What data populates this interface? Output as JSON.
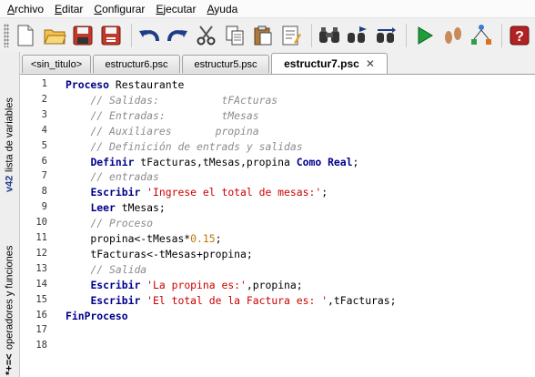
{
  "menu": [
    "Archivo",
    "Editar",
    "Configurar",
    "Ejecutar",
    "Ayuda"
  ],
  "toolbar_icons": [
    "new-file-icon",
    "open-folder-icon",
    "save-icon",
    "save-as-icon",
    "undo-icon",
    "redo-icon",
    "cut-icon",
    "copy-icon",
    "paste-icon",
    "edit-flow-icon",
    "search-icon",
    "search-next-icon",
    "replace-icon",
    "run-icon",
    "step-by-step-icon",
    "explain-icon",
    "help-icon"
  ],
  "sidebar": {
    "variables_icon": "v⁢42",
    "variables_label": "lista de variables",
    "operators_icon": "*+=<",
    "operators_label": "operadores y funciones"
  },
  "tabs": [
    {
      "label": "<sin_titulo>",
      "active": false
    },
    {
      "label": "estructur6.psc",
      "active": false
    },
    {
      "label": "estructur5.psc",
      "active": false
    },
    {
      "label": "estructur7.psc",
      "active": true
    }
  ],
  "tab_close": "✕",
  "editor": {
    "line_numbers": [
      "1",
      "2",
      "3",
      "4",
      "5",
      "6",
      "7",
      "8",
      "9",
      "10",
      "11",
      "12",
      "13",
      "14",
      "15",
      "16",
      "17",
      "18"
    ],
    "lines": [
      "Proceso Restaurante",
      "    // Salidas:          tFActuras",
      "    // Entradas:         tMesas",
      "    // Auxiliares       propina",
      "    // Definición de entrads y salidas",
      "    Definir tFacturas,tMesas,propina Como Real;",
      "    // entradas",
      "    Escribir 'Ingrese el total de mesas:';",
      "    Leer tMesas;",
      "    // Proceso",
      "    propina<-tMesas*0.15;",
      "    tFacturas<-tMesas+propina;",
      "    // Salida",
      "    Escribir 'La propina es:',propina;",
      "    Escribir 'El total de la Factura es: ',tFacturas;",
      "FinProceso",
      "",
      ""
    ]
  },
  "colors": {
    "keyword": "#00008b",
    "comment": "#8c8c8c",
    "string": "#cc0000",
    "number": "#b87a00"
  }
}
